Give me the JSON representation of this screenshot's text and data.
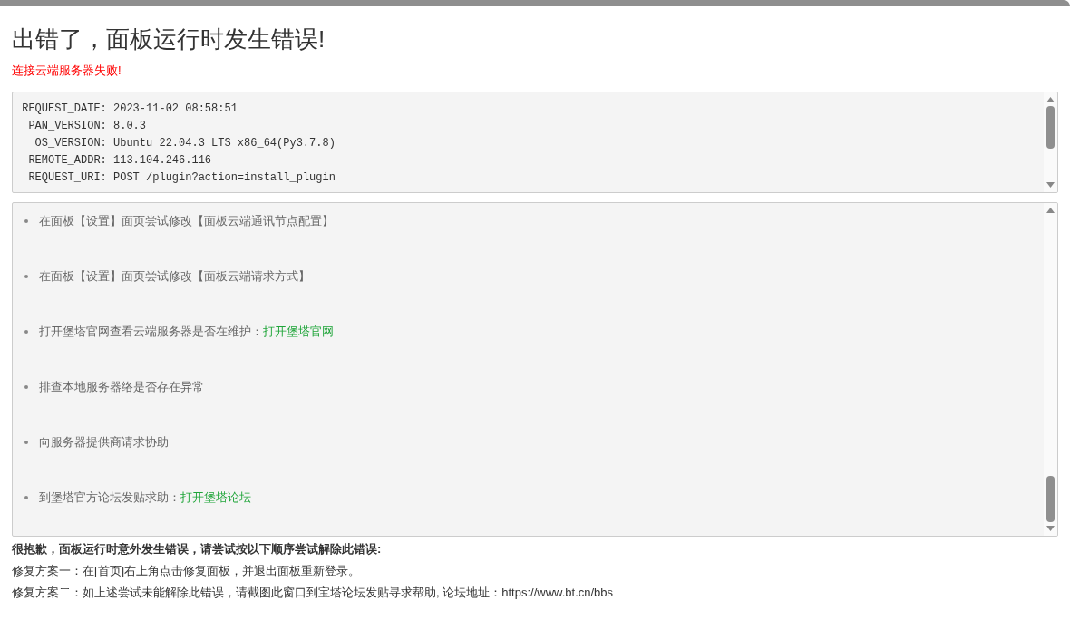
{
  "title": "出错了，面板运行时发生错误!",
  "error_message": "连接云端服务器失败!",
  "request_log": [
    " REQUEST_DATE: 2023-11-02 08:58:51",
    "  PAN_VERSION: 8.0.3",
    "   OS_VERSION: Ubuntu 22.04.3 LTS x86_64(Py3.7.8)",
    "  REMOTE_ADDR: 113.104.246.116",
    "  REQUEST_URI: POST /plugin?action=install_plugin"
  ],
  "suggestions": [
    {
      "text": "在面板【设置】面页尝试修改【面板云端通讯节点配置】"
    },
    {
      "text": "在面板【设置】面页尝试修改【面板云端请求方式】"
    },
    {
      "text": "打开堡塔官网查看云端服务器是否在维护：",
      "link": "打开堡塔官网"
    },
    {
      "text": "排查本地服务器络是否存在异常"
    },
    {
      "text": "向服务器提供商请求协助"
    },
    {
      "text": "到堡塔官方论坛发贴求助：",
      "link": "打开堡塔论坛"
    }
  ],
  "apology": "很抱歉，面板运行时意外发生错误，请尝试按以下顺序尝试解除此错误:",
  "fixes": [
    "修复方案一：在[首页]右上角点击修复面板，并退出面板重新登录。",
    "修复方案二：如上述尝试未能解除此错误，请截图此窗口到宝塔论坛发贴寻求帮助, 论坛地址：https://www.bt.cn/bbs"
  ]
}
